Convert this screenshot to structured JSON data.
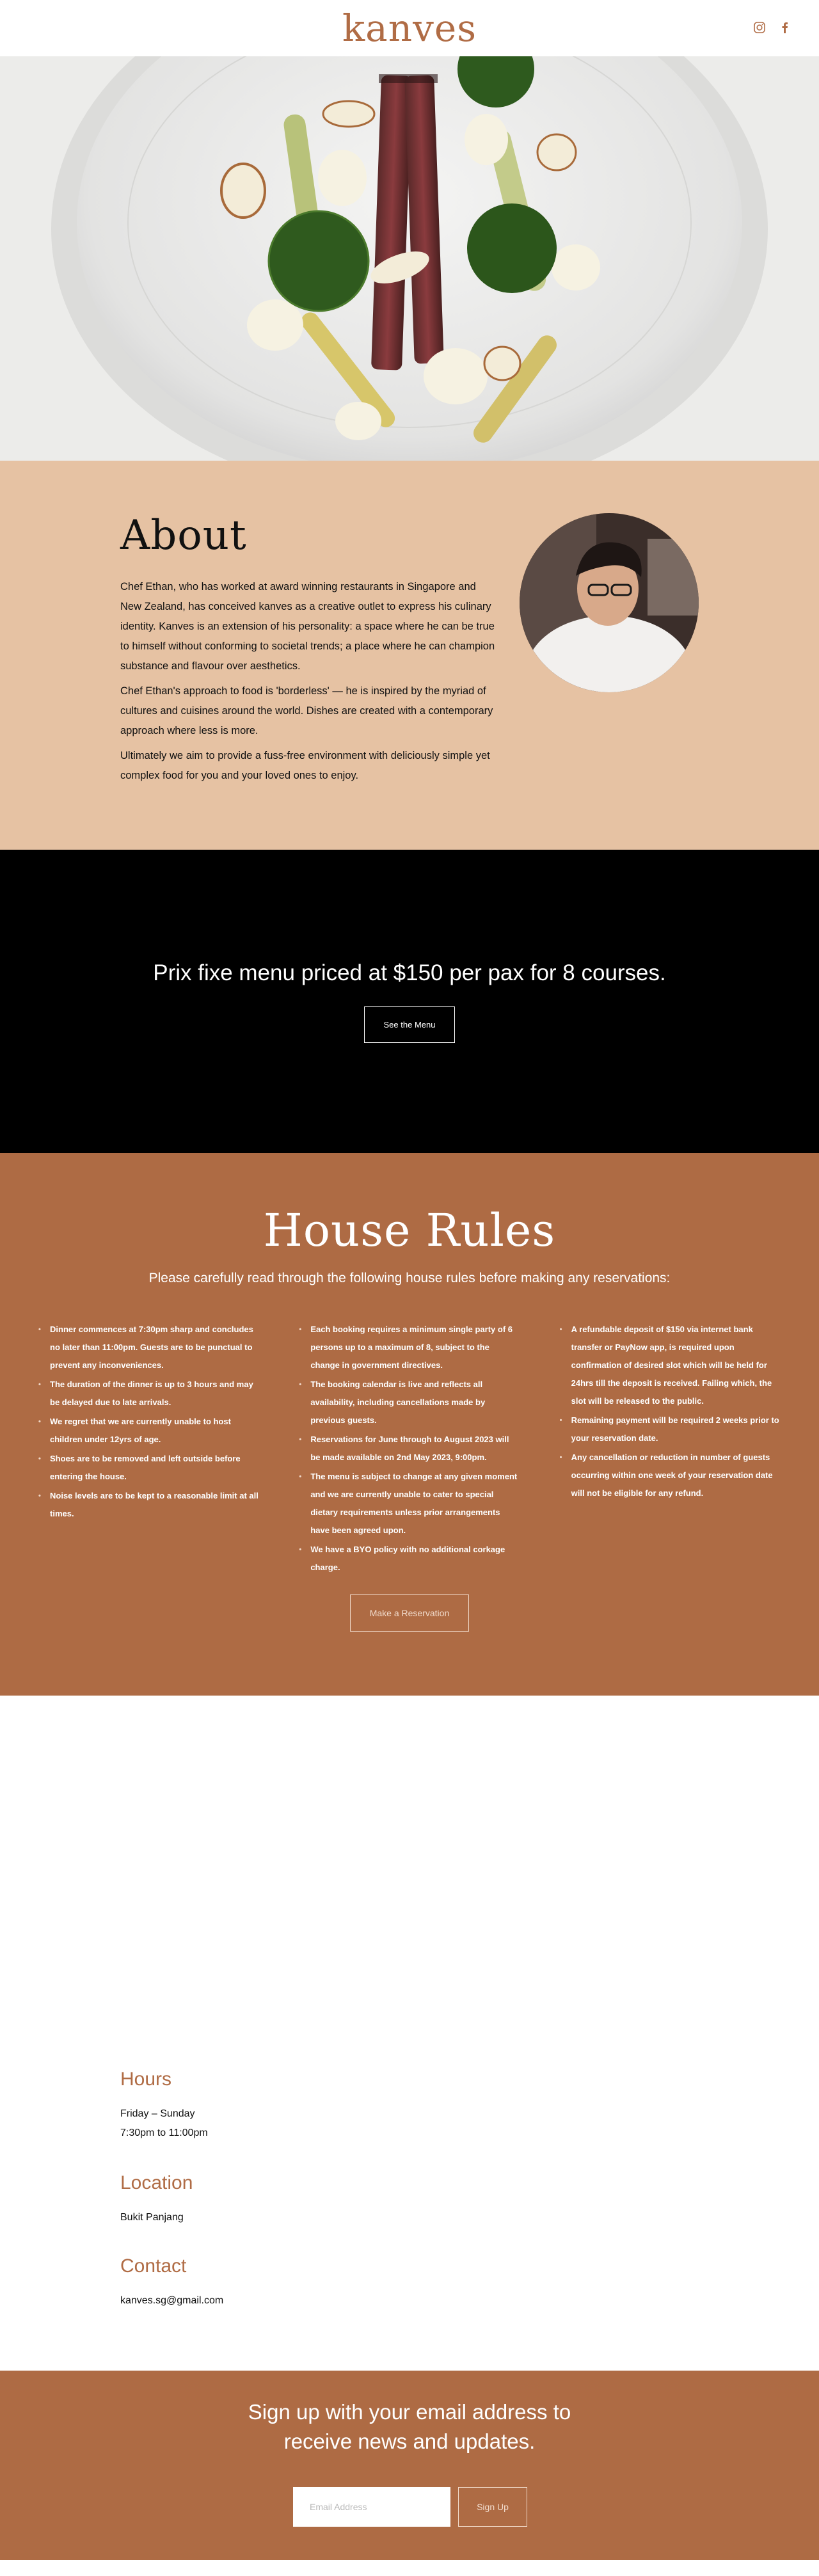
{
  "header": {
    "logo": "kanves",
    "social": [
      "instagram-icon",
      "facebook-icon"
    ],
    "brand_color": "#b06c45"
  },
  "hero": {
    "image": "plated-beef-dish-photo"
  },
  "about": {
    "title": "About",
    "paragraphs": [
      "Chef Ethan, who has worked at award winning restaurants in Singapore and New Zealand, has conceived kanves as a creative outlet to express his culinary identity. Kanves is an extension of his personality: a space where he can be true to himself without conforming to societal trends; a place where he can champion substance and flavour over aesthetics.",
      "Chef Ethan's approach to food is 'borderless' — he is inspired by the myriad of cultures and cuisines around the world. Dishes are created with a contemporary approach where less is more.",
      "Ultimately we aim to provide a fuss-free environment with deliciously simple yet complex food for you and your loved ones to enjoy."
    ],
    "background": "#e6c2a3"
  },
  "menu": {
    "headline": "Prix fixe menu priced at $150 per pax for 8 courses.",
    "button_label": "See the Menu"
  },
  "rules": {
    "title": "House Rules",
    "intro": "Please carefully read through the following house rules before making any reservations:",
    "columns": [
      [
        "Dinner commences at 7:30pm sharp and concludes no later than 11:00pm. Guests are to be punctual to prevent any inconveniences.",
        "The duration of the dinner is up to 3 hours and may be delayed due to late arrivals.",
        "We regret that we are currently unable to host children under 12yrs of age.",
        "Shoes are to be removed and left outside before entering the house.",
        "Noise levels are to be kept to a reasonable limit at all times."
      ],
      [
        "Each booking requires a minimum single party of 6 persons up to a maximum of 8, subject to the change in government directives.",
        "The booking calendar is live and reflects all availability, including cancellations made by previous guests.",
        "Reservations for June through to August 2023 will be made available on 2nd May 2023, 9:00pm.",
        "The menu is subject to change at any given moment and we are currently unable to cater to special dietary requirements unless prior arrangements have been agreed upon.",
        "We have a BYO policy with no additional corkage charge."
      ],
      [
        "A refundable deposit of $150 via internet bank transfer or PayNow app, is required upon confirmation of desired slot which will be held for 24hrs till the deposit is received. Failing which, the slot will be released to the public.",
        "Remaining payment will be required 2 weeks prior to your reservation date.",
        "Any cancellation or reduction in number of guests occurring within one week of your reservation date will not be eligible for any refund."
      ]
    ],
    "button_label": "Make a Reservation",
    "background": "#ae6b44"
  },
  "info": {
    "hours_title": "Hours",
    "hours_days": "Friday – Sunday",
    "hours_time": "7:30pm to 11:00pm",
    "location_title": "Location",
    "location": "Bukit Panjang",
    "contact_title": "Contact",
    "email": "kanves.sg@gmail.com"
  },
  "signup": {
    "line1": "Sign up with your email address to",
    "line2": "receive news and updates.",
    "email_placeholder": "Email Address",
    "button_label": "Sign Up"
  }
}
